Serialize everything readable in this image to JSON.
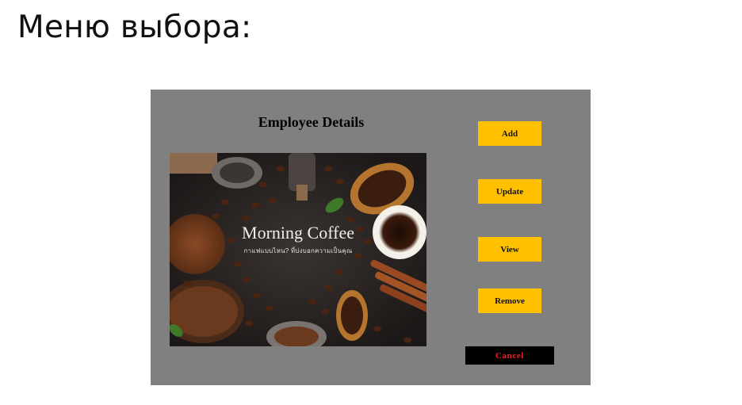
{
  "slide": {
    "title": "Меню выбора:"
  },
  "window": {
    "title": "Employee Details",
    "image": {
      "caption": "Morning Coffee",
      "subcaption": "กาแฟแบบไหน? ที่บ่งบอกความเป็นคุณ"
    },
    "buttons": {
      "add": "Add",
      "update": "Update",
      "view": "View",
      "remove": "Remove",
      "cancel": "Cancel"
    }
  },
  "colors": {
    "window_bg": "#808080",
    "button_bg": "#ffc000",
    "cancel_bg": "#000000",
    "cancel_text": "#ff1a1a"
  }
}
